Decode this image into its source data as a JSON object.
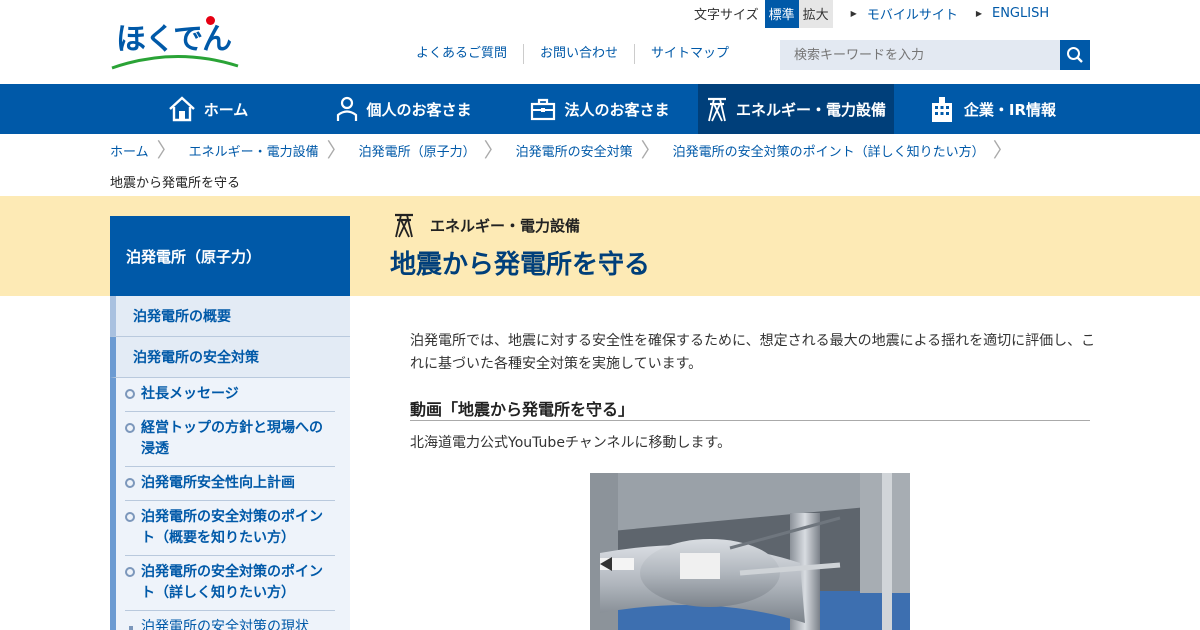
{
  "header": {
    "logo_text": "ほくでん",
    "text_size_label": "文字サイズ",
    "size_standard": "標準",
    "size_large": "拡大",
    "mobile_link": "モバイルサイト",
    "english_link": "ENGLISH",
    "sublinks": [
      "よくあるご質問",
      "お問い合わせ",
      "サイトマップ"
    ],
    "search_placeholder": "検索キーワードを入力"
  },
  "gnav": [
    {
      "label": "ホーム",
      "icon": "home-icon"
    },
    {
      "label": "個人のお客さま",
      "icon": "person-icon"
    },
    {
      "label": "法人のお客さま",
      "icon": "briefcase-icon"
    },
    {
      "label": "エネルギー・電力設備",
      "icon": "pylon-icon"
    },
    {
      "label": "企業・IR情報",
      "icon": "building-icon"
    }
  ],
  "breadcrumb": [
    "ホーム",
    "エネルギー・電力設備",
    "泊発電所（原子力）",
    "泊発電所の安全対策",
    "泊発電所の安全対策のポイント（詳しく知りたい方）"
  ],
  "breadcrumb_current": "地震から発電所を守る",
  "page": {
    "category": "エネルギー・電力設備",
    "title": "地震から発電所を守る"
  },
  "sidebar": {
    "title": "泊発電所（原子力）",
    "level1": [
      "泊発電所の概要",
      "泊発電所の安全対策"
    ],
    "level2": [
      "社長メッセージ",
      "経営トップの方針と現場への浸透",
      "泊発電所安全性向上計画",
      "泊発電所の安全対策のポイント（概要を知りたい方）",
      "泊発電所の安全対策のポイント（詳しく知りたい方）"
    ],
    "level3": [
      "泊発電所の安全対策の現状（全体イメージ）"
    ]
  },
  "content": {
    "intro": "泊発電所では、地震に対する安全性を確保するために、想定される最大の地震による揺れを適切に評価し、これに基づいた各種安全対策を実施しています。",
    "video_heading": "動画「地震から発電所を守る」",
    "video_note": "北海道電力公式YouTubeチャンネルに移動します。"
  },
  "colors": {
    "brand_blue": "#0059a8",
    "nav_active": "#003f7a",
    "band_yellow": "#fdeab5",
    "logo_red": "#e60012",
    "logo_green": "#2aa336"
  }
}
